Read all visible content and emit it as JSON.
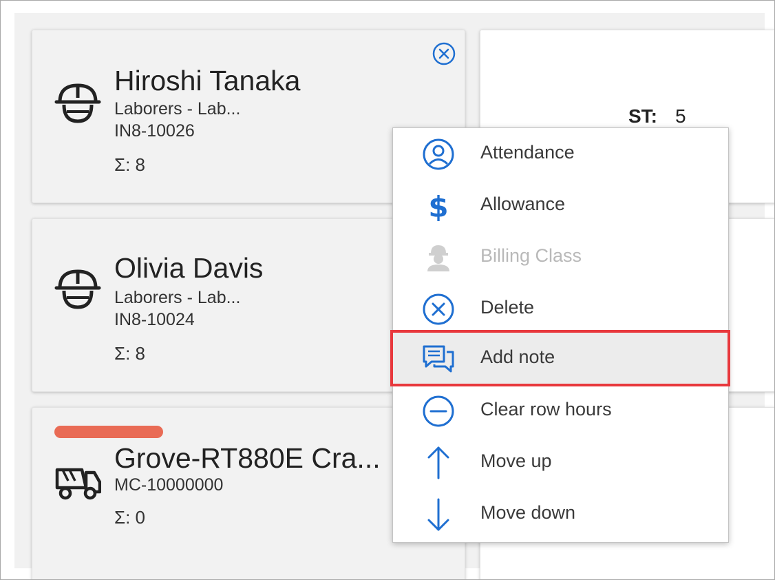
{
  "cards": [
    {
      "name": "Hiroshi Tanaka",
      "trade": "Laborers - Lab...",
      "code": "IN8-10026",
      "sum": "Σ: 8",
      "icon": "hard-hat-worker-icon"
    },
    {
      "name": "Olivia Davis",
      "trade": "Laborers - Lab...",
      "code": "IN8-10024",
      "sum": "Σ: 8",
      "icon": "hard-hat-worker-icon"
    },
    {
      "name": "Grove-RT880E Cra...",
      "code": "MC-10000000",
      "sum": "Σ: 0",
      "icon": "dump-truck-icon",
      "status_color": "#e96b55"
    }
  ],
  "hours": {
    "st_label": "ST:",
    "st_value": "5"
  },
  "context_menu": {
    "items": [
      {
        "label": "Attendance",
        "icon": "user-circle-icon",
        "enabled": true
      },
      {
        "label": "Allowance",
        "icon": "dollar-icon",
        "enabled": true
      },
      {
        "label": "Billing Class",
        "icon": "worker-icon",
        "enabled": false
      },
      {
        "label": "Delete",
        "icon": "circle-x-icon",
        "enabled": true
      },
      {
        "label": "Add note",
        "icon": "chat-bubbles-icon",
        "enabled": true,
        "highlighted": true
      },
      {
        "label": "Clear row hours",
        "icon": "circle-minus-icon",
        "enabled": true
      },
      {
        "label": "Move up",
        "icon": "arrow-up-icon",
        "enabled": true
      },
      {
        "label": "Move down",
        "icon": "arrow-down-icon",
        "enabled": true
      }
    ]
  },
  "colors": {
    "accent": "#1f6fd1",
    "highlight_border": "#e8383d",
    "disabled": "#b9b9b9"
  }
}
